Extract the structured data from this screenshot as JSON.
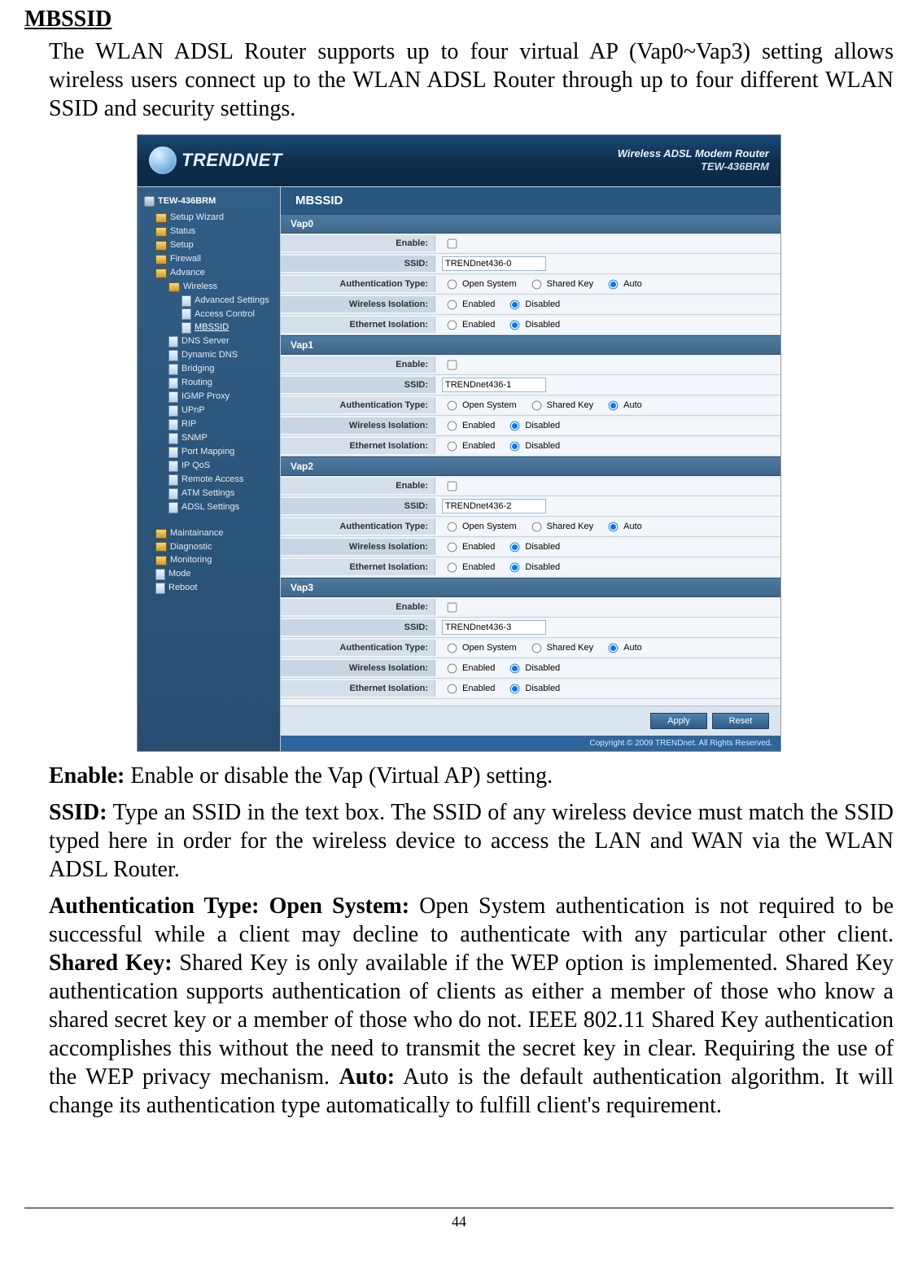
{
  "doc": {
    "heading": "MBSSID",
    "intro": "The WLAN ADSL Router supports up to four virtual AP (Vap0~Vap3) setting allows wireless users connect up to the WLAN ADSL Router through up to four different WLAN SSID and security settings.",
    "p_enable_b": "Enable:",
    "p_enable": " Enable or disable the Vap (Virtual AP) setting.",
    "p_ssid_b": "SSID:",
    "p_ssid": " Type an SSID in the text box. The SSID of any wireless device must match the SSID typed here in order for the wireless device to access the LAN and WAN via the WLAN ADSL Router.",
    "p_auth_b1": "Authentication Type: Open System:",
    "p_auth_1": " Open System authentication is not required to be successful while a client may decline to authenticate with any particular other client. ",
    "p_auth_b2": "Shared Key:",
    "p_auth_2": " Shared Key is only available if the WEP option is implemented. Shared Key authentication supports authentication of clients as either a member of those who know a shared secret key or a member of those who do not. IEEE 802.11 Shared Key authentication accomplishes this without the need to transmit the secret key in clear. Requiring the use of the WEP privacy mechanism. ",
    "p_auth_b3": "Auto:",
    "p_auth_3": " Auto is the default authentication algorithm. It will change its authentication type automatically to fulfill client's requirement.",
    "page_num": "44"
  },
  "shot": {
    "brand": "TRENDNET",
    "model_line1": "Wireless ADSL Modem Router",
    "model_line2": "TEW-436BRM",
    "panel_title": "MBSSID",
    "copyright": "Copyright © 2009 TRENDnet. All Rights Reserved.",
    "btn_apply": "Apply",
    "btn_reset": "Reset",
    "labels": {
      "enable": "Enable:",
      "ssid": "SSID:",
      "auth": "Authentication Type:",
      "wiso": "Wireless Isolation:",
      "eiso": "Ethernet Isolation:",
      "open": "Open System",
      "shared": "Shared Key",
      "auto": "Auto",
      "enabled": "Enabled",
      "disabled": "Disabled"
    },
    "vaps": [
      {
        "title": "Vap0",
        "ssid": "TRENDnet436-0"
      },
      {
        "title": "Vap1",
        "ssid": "TRENDnet436-1"
      },
      {
        "title": "Vap2",
        "ssid": "TRENDnet436-2"
      },
      {
        "title": "Vap3",
        "ssid": "TRENDnet436-3"
      }
    ],
    "tree": {
      "root": "TEW-436BRM",
      "items": [
        {
          "lvl": 1,
          "ic": "ic",
          "label": "Setup Wizard"
        },
        {
          "lvl": 1,
          "ic": "ic",
          "label": "Status"
        },
        {
          "lvl": 1,
          "ic": "ic",
          "label": "Setup"
        },
        {
          "lvl": 1,
          "ic": "ic",
          "label": "Firewall"
        },
        {
          "lvl": 1,
          "ic": "ic",
          "label": "Advance"
        },
        {
          "lvl": 2,
          "ic": "ic",
          "label": "Wireless"
        },
        {
          "lvl": 3,
          "ic": "ic-file",
          "label": "Advanced Settings"
        },
        {
          "lvl": 3,
          "ic": "ic-file",
          "label": "Access Control"
        },
        {
          "lvl": 3,
          "ic": "ic-file",
          "label": "MBSSID",
          "sel": true
        },
        {
          "lvl": 2,
          "ic": "ic-file",
          "label": "DNS Server"
        },
        {
          "lvl": 2,
          "ic": "ic-file",
          "label": "Dynamic DNS"
        },
        {
          "lvl": 2,
          "ic": "ic-file",
          "label": "Bridging"
        },
        {
          "lvl": 2,
          "ic": "ic-file",
          "label": "Routing"
        },
        {
          "lvl": 2,
          "ic": "ic-file",
          "label": "IGMP Proxy"
        },
        {
          "lvl": 2,
          "ic": "ic-file",
          "label": "UPnP"
        },
        {
          "lvl": 2,
          "ic": "ic-file",
          "label": "RIP"
        },
        {
          "lvl": 2,
          "ic": "ic-file",
          "label": "SNMP"
        },
        {
          "lvl": 2,
          "ic": "ic-file",
          "label": "Port Mapping"
        },
        {
          "lvl": 2,
          "ic": "ic-file",
          "label": "IP QoS"
        },
        {
          "lvl": 2,
          "ic": "ic-file",
          "label": "Remote Access"
        },
        {
          "lvl": 2,
          "ic": "ic-file",
          "label": "ATM Settings"
        },
        {
          "lvl": 2,
          "ic": "ic-file",
          "label": "ADSL Settings"
        }
      ],
      "group2": [
        {
          "lvl": 1,
          "ic": "ic",
          "label": "Maintainance"
        },
        {
          "lvl": 1,
          "ic": "ic",
          "label": "Diagnostic"
        },
        {
          "lvl": 1,
          "ic": "ic",
          "label": "Monitoring"
        },
        {
          "lvl": 1,
          "ic": "ic-file",
          "label": "Mode"
        },
        {
          "lvl": 1,
          "ic": "ic-file",
          "label": "Reboot"
        }
      ]
    }
  }
}
